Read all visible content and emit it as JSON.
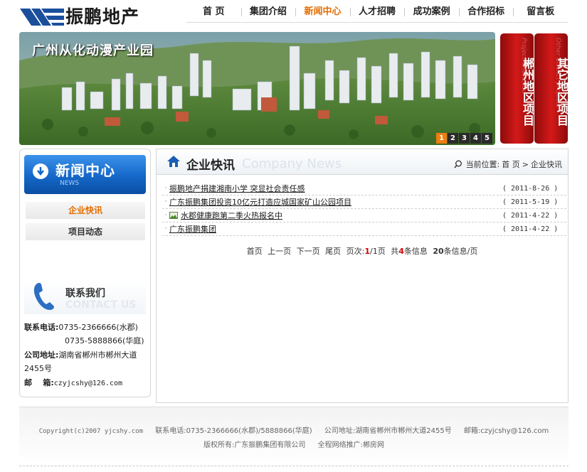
{
  "logo": {
    "text": "振鹏地产"
  },
  "nav": {
    "items": [
      {
        "label": "首 页",
        "active": false
      },
      {
        "label": "集团介绍",
        "active": false
      },
      {
        "label": "新闻中心",
        "active": true
      },
      {
        "label": "人才招聘",
        "active": false
      },
      {
        "label": "成功案例",
        "active": false
      },
      {
        "label": "合作招标",
        "active": false
      },
      {
        "label": "留言板",
        "active": false
      }
    ]
  },
  "banner": {
    "title": "广州从化动漫产业园",
    "pager": [
      "1",
      "2",
      "3",
      "4",
      "5"
    ],
    "active_page": "1"
  },
  "side_tabs": [
    {
      "label": "郴州地区项目",
      "deco": "Project Chenzhou"
    },
    {
      "label": "其它地区项目",
      "deco": "Other district projects"
    }
  ],
  "sidebar": {
    "title": "新闻中心",
    "subtitle": "NEWS",
    "menu": [
      {
        "label": "企业快讯",
        "active": true
      },
      {
        "label": "项目动态",
        "active": false
      }
    ],
    "contact": {
      "title": "联系我们",
      "subtitle": "CONTACT US",
      "phone_label": "联系电话:",
      "phone1": "0735-2366666(水郡)",
      "phone2": "0735-5888866(华庭)",
      "address_label": "公司地址:",
      "address_line1": "湖南省郴州市郴州大道",
      "address_line2": "2455号",
      "email_label": "邮    箱:",
      "email": "czyjcshy@126.com"
    }
  },
  "main": {
    "title": "企业快讯",
    "title_en": "Company News",
    "crumb_label": "当前位置:",
    "crumb_home": "首 页",
    "crumb_sep": ">",
    "crumb_current": "企业快讯",
    "news": [
      {
        "title": "振鹏地产捐建湘南小学 突显社会责任感",
        "date": "( 2011-8-26 )",
        "has_image": false
      },
      {
        "title": "广东振鹏集团投资10亿元打造应城国家矿山公园项目",
        "date": "( 2011-5-19 )",
        "has_image": false
      },
      {
        "title": "水郡健康跑第二季火热报名中",
        "date": "( 2011-4-22 )",
        "has_image": true
      },
      {
        "title": "广东振鹏集团",
        "date": "( 2011-4-22 )",
        "has_image": false
      }
    ],
    "pagination": {
      "first": "首页",
      "prev": "上一页",
      "next": "下一页",
      "last": "尾页",
      "page_label": "页次:",
      "current": "1",
      "total_pages": "/1页",
      "total_label": "共",
      "total_items": "4",
      "items_label": "条信息",
      "per_page": "20",
      "per_page_label": "条信息/页"
    }
  },
  "footer": {
    "copyright": "Copyright(c)2007 yjcshy.com",
    "phone": "联系电话:0735-2366666(水郡)/5888866(华庭)",
    "address": "公司地址:湖南省郴州市郴州大道2455号",
    "email": "邮箱:czyjcshy@126.com",
    "rights": "版权所有:广东振鹏集团有限公司",
    "promo": "全程网络推广:郴房网"
  }
}
